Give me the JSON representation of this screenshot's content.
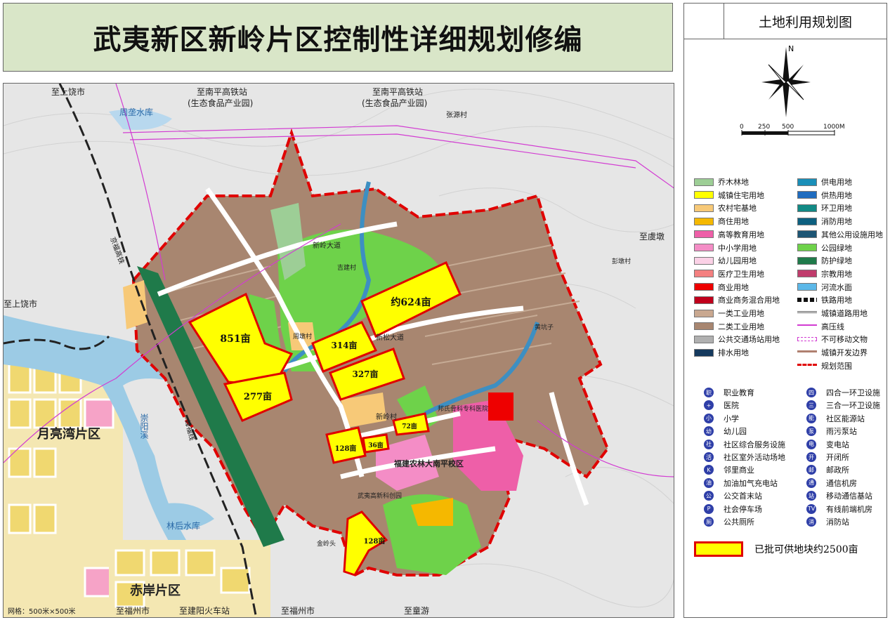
{
  "title": "武夷新区新岭片区控制性详细规划修编",
  "panel": {
    "heading": "土地利用规划图",
    "north": "N",
    "scale_labels": [
      "0",
      "250",
      "500",
      "1000M"
    ]
  },
  "map_labels": {
    "to_shangrao_top": "至上饶市",
    "to_nanping_1": "至南平高铁站",
    "eco_park_1": "(生态食品产业园)",
    "to_nanping_2": "至南平高铁站",
    "eco_park_2": "(生态食品产业园)",
    "zhoukui": "周垄水库",
    "zhangyuan": "张源村",
    "to_yuqiao": "至虞墩",
    "to_shangrao_left": "至上饶市",
    "yueliangwan": "月亮湾片区",
    "chongyang": "崇阳溪",
    "linhou": "林后水库",
    "chian": "赤岸片区",
    "grid": "网格：500米×500米",
    "to_fuzhou_1": "至福州市",
    "to_jianyang": "至建阳火车站",
    "to_fuzhou_2": "至福州市",
    "to_tongyou": "至童游",
    "xinling_road": "新岭大道",
    "xinsong_road": "新松大道",
    "xinling_village": "新岭村",
    "zhouduncun": "周墩村",
    "gujian": "吉建村",
    "nanping_campus": "福建农林大南平校区",
    "hospital": "邦氏骨科专科医院",
    "pengdun": "彭墩村",
    "jinlingtou": "金岭头",
    "huangkengzi": "黄坑子",
    "wuyi_tech": "武夷高新科创园",
    "nanping_railway": "京福高铁",
    "pengxi_line": "峰福线"
  },
  "parcels": [
    {
      "label": "851亩"
    },
    {
      "label": "277亩"
    },
    {
      "label": "314亩"
    },
    {
      "label": "327亩"
    },
    {
      "label": "约624亩"
    },
    {
      "label": "128亩"
    },
    {
      "label": "36亩"
    },
    {
      "label": "72亩"
    },
    {
      "label": "128亩"
    }
  ],
  "legend_left": [
    {
      "label": "乔木林地",
      "color": "#9dce96"
    },
    {
      "label": "城镇住宅用地",
      "color": "#ffff00"
    },
    {
      "label": "农村宅基地",
      "color": "#f7c978"
    },
    {
      "label": "商住用地",
      "color": "#f5b800"
    },
    {
      "label": "高等教育用地",
      "color": "#ee5fa8"
    },
    {
      "label": "中小学用地",
      "color": "#f48dc6"
    },
    {
      "label": "幼儿园用地",
      "color": "#fbd1e6"
    },
    {
      "label": "医疗卫生用地",
      "color": "#f48080"
    },
    {
      "label": "商业用地",
      "color": "#ee0000"
    },
    {
      "label": "商业商务混合用地",
      "color": "#c0001c"
    },
    {
      "label": "一类工业用地",
      "color": "#c9a890"
    },
    {
      "label": "二类工业用地",
      "color": "#a88670"
    },
    {
      "label": "公共交通场站用地",
      "color": "#b0b0b0"
    },
    {
      "label": "排水用地",
      "color": "#153a5e"
    }
  ],
  "legend_right": [
    {
      "label": "供电用地",
      "color": "#1a8fb8"
    },
    {
      "label": "供热用地",
      "color": "#1f6cbf"
    },
    {
      "label": "环卫用地",
      "color": "#128a85"
    },
    {
      "label": "消防用地",
      "color": "#0d6080"
    },
    {
      "label": "其他公用设施用地",
      "color": "#1d5574"
    },
    {
      "label": "公园绿地",
      "color": "#6ed24a"
    },
    {
      "label": "防护绿地",
      "color": "#1f7a4a"
    },
    {
      "label": "宗教用地",
      "color": "#c03c6c"
    },
    {
      "label": "河流水面",
      "color": "#5cb8e8"
    },
    {
      "label": "铁路用地",
      "color": "line-rail"
    },
    {
      "label": "城镇道路用地",
      "color": "line-road"
    },
    {
      "label": "高压线",
      "color": "line-power"
    },
    {
      "label": "不可移动文物",
      "color": "line-relic"
    },
    {
      "label": "城镇开发边界",
      "color": "line-boundary"
    },
    {
      "label": "规划范围",
      "color": "line-range"
    }
  ],
  "facilities_left": [
    {
      "label": "职业教育",
      "icon": "职"
    },
    {
      "label": "医院",
      "icon": "+"
    },
    {
      "label": "小学",
      "icon": "小"
    },
    {
      "label": "幼儿园",
      "icon": "幼"
    },
    {
      "label": "社区综合服务设施",
      "icon": "社"
    },
    {
      "label": "社区室外活动场地",
      "icon": "活"
    },
    {
      "label": "邻里商业",
      "icon": "K"
    },
    {
      "label": "加油加气充电站",
      "icon": "油"
    },
    {
      "label": "公交首末站",
      "icon": "公"
    },
    {
      "label": "社会停车场",
      "icon": "P"
    },
    {
      "label": "公共厕所",
      "icon": "厕"
    }
  ],
  "facilities_right": [
    {
      "label": "四合一环卫设施",
      "icon": "四"
    },
    {
      "label": "三合一环卫设施",
      "icon": "三"
    },
    {
      "label": "社区能源站",
      "icon": "能"
    },
    {
      "label": "雨污泵站",
      "icon": "泵"
    },
    {
      "label": "变电站",
      "icon": "电"
    },
    {
      "label": "开闭所",
      "icon": "开"
    },
    {
      "label": "邮政所",
      "icon": "邮"
    },
    {
      "label": "通信机房",
      "icon": "通"
    },
    {
      "label": "移动通信基站",
      "icon": "站"
    },
    {
      "label": "有线前端机房",
      "icon": "TV"
    },
    {
      "label": "消防站",
      "icon": "消"
    }
  ],
  "approved_note": "已批可供地块约2500亩",
  "colors": {
    "range_line": "#e00000",
    "residential": "#ffff00",
    "industrial": "#a88670",
    "green": "#6ed24a",
    "forest": "#9dce96",
    "education": "#ee5fa8"
  }
}
